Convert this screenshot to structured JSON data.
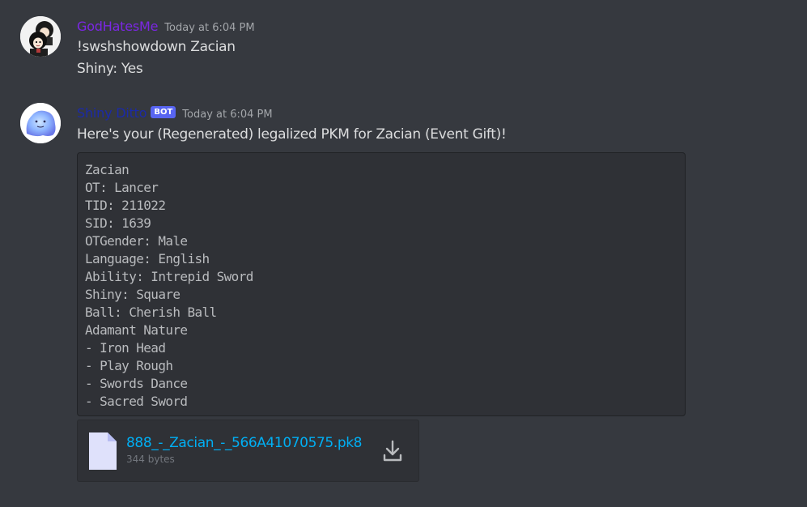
{
  "colors": {
    "background": "#36393f",
    "godhatesme_name": "#7b27e3",
    "shinyditto_name": "#1b2aa8",
    "bot_tag": "#5865f2",
    "link": "#00aff4"
  },
  "messages": [
    {
      "avatar_icon": "anime-character-avatar-icon",
      "username": "GodHatesMe",
      "timestamp": "Today at 6:04 PM",
      "lines": [
        "!swshshowdown Zacian",
        "Shiny: Yes"
      ]
    },
    {
      "avatar_icon": "shiny-ditto-avatar-icon",
      "username": "Shiny Ditto",
      "bot_tag": "BOT",
      "timestamp": "Today at 6:04 PM",
      "text": "Here's your (Regenerated) legalized PKM for Zacian (Event Gift)!",
      "code_lines": [
        "Zacian",
        "OT: Lancer",
        "TID: 211022",
        "SID: 1639",
        "OTGender: Male",
        "Language: English",
        "Ability: Intrepid Sword",
        "Shiny: Square",
        "Ball: Cherish Ball",
        "Adamant Nature",
        "- Iron Head",
        "- Play Rough",
        "- Swords Dance",
        "- Sacred Sword"
      ],
      "attachment": {
        "file_icon": "file-icon",
        "filename": "888_-_Zacian_-_566A41070575.pk8",
        "size": "344 bytes",
        "download_icon": "download-icon"
      }
    }
  ]
}
